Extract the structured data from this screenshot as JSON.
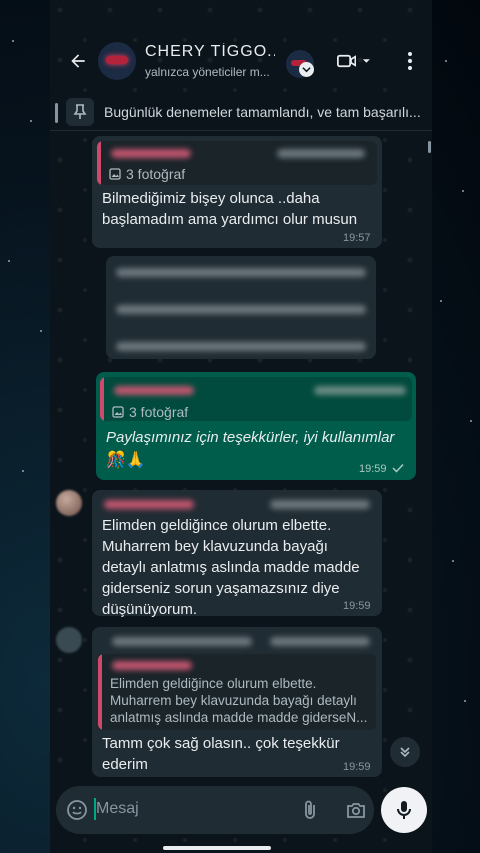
{
  "header": {
    "title": "CHERY TİGGO...",
    "subtitle": "yalnızca yöneticiler m..."
  },
  "pinned": {
    "text": "Bugünlük denemeler tamamlandı, ve tam başarılı..."
  },
  "messages": [
    {
      "direction": "in",
      "quote_media": "3 fotoğraf",
      "text": "Bilmediğimiz bişey olunca ..daha başlamadım ama yardımcı olur musun",
      "time": "19:57"
    },
    {
      "direction": "out",
      "quote_media": "3 fotoğraf",
      "text": "Paylaşımınız için teşekkürler, iyi kullanımlar",
      "emoji": "🎊🙏",
      "time": "19:59",
      "status": "sent"
    },
    {
      "direction": "in",
      "text": "Elimden geldiğince olurum elbette. Muharrem bey klavuzunda bayağı detaylı anlatmış aslında madde madde giderseniz sorun yaşamazsınız diye düşünüyorum.",
      "time": "19:59"
    },
    {
      "direction": "in",
      "quote_text": "Elimden geldiğince olurum elbette. Muharrem bey klavuzunda bayağı detaylı anlatmış aslında madde madde giderseN...",
      "text": "Tamm çok sağ olasın.. çok teşekkür ederim",
      "time": "19:59"
    }
  ],
  "composer": {
    "placeholder": "Mesaj"
  },
  "colors": {
    "background": "#0b141a",
    "incoming": "#202c33",
    "outgoing": "#005c4b",
    "accent": "#00a884",
    "quote_bar": "#d0496b"
  }
}
